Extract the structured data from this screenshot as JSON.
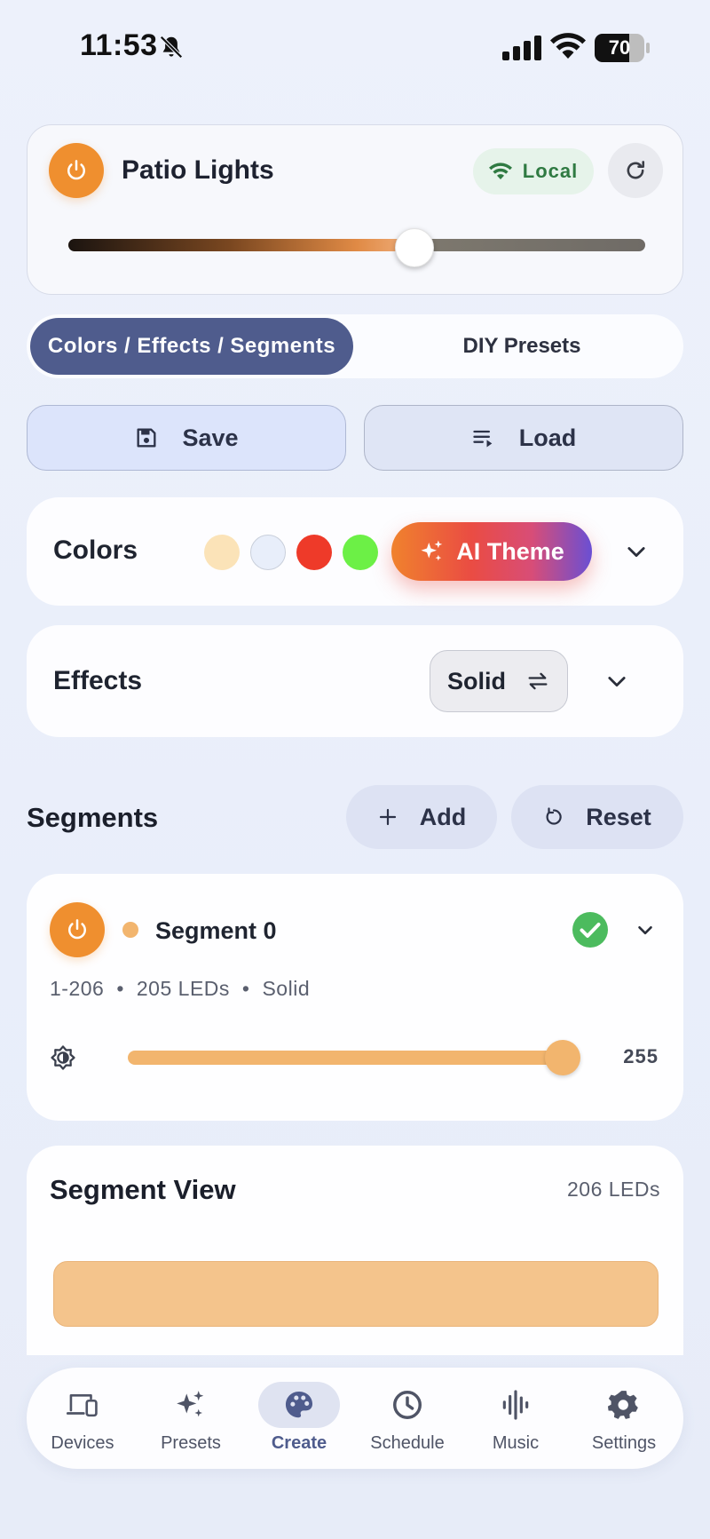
{
  "status_bar": {
    "time": "11:53",
    "battery": "70",
    "battery_level": 0.7
  },
  "device": {
    "name": "Patio Lights",
    "connection_label": "Local",
    "brightness_fraction": 0.6
  },
  "tabs": [
    {
      "label": "Colors / Effects / Segments",
      "active": true
    },
    {
      "label": "DIY Presets",
      "active": false
    }
  ],
  "actions": {
    "save_label": "Save",
    "load_label": "Load"
  },
  "colors": {
    "title": "Colors",
    "swatches": [
      "#fbe3b8",
      "#e8eefa",
      "#ee3a29",
      "#6cf046"
    ],
    "ai_theme_label": "AI Theme"
  },
  "effects": {
    "title": "Effects",
    "current_effect": "Solid"
  },
  "segments": {
    "title": "Segments",
    "add_label": "Add",
    "reset_label": "Reset",
    "items": [
      {
        "name": "Segment 0",
        "range": "1-206",
        "led_count_label": "205 LEDs",
        "effect": "Solid",
        "brightness": "255",
        "brightness_fraction": 1.0,
        "color": "#f2b56e"
      }
    ]
  },
  "segment_view": {
    "title": "Segment View",
    "led_count_label": "206 LEDs",
    "strip_color": "#f4c48c"
  },
  "nav": {
    "items": [
      {
        "label": "Devices",
        "icon": "devices-icon",
        "active": false
      },
      {
        "label": "Presets",
        "icon": "sparkles-icon",
        "active": false
      },
      {
        "label": "Create",
        "icon": "palette-icon",
        "active": true
      },
      {
        "label": "Schedule",
        "icon": "clock-icon",
        "active": false
      },
      {
        "label": "Music",
        "icon": "waveform-icon",
        "active": false
      },
      {
        "label": "Settings",
        "icon": "gear-icon",
        "active": false
      }
    ]
  },
  "theme": {
    "accent": "#ef8f2f",
    "primary": "#4f5c8d",
    "success": "#4cbb5e"
  }
}
